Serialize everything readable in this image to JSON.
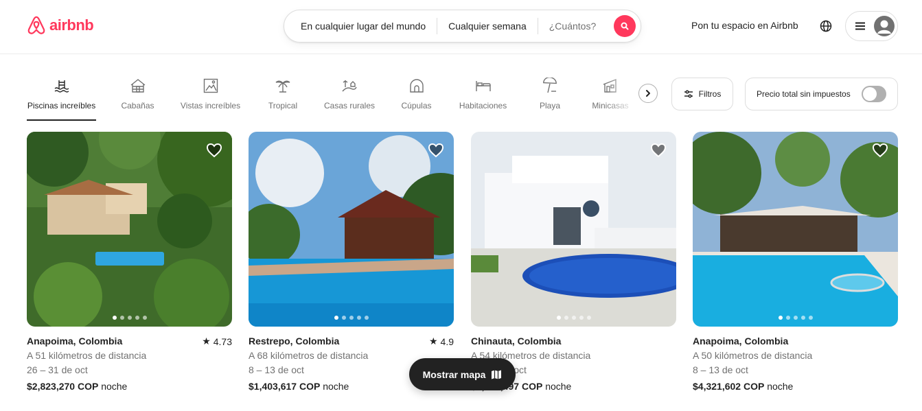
{
  "header": {
    "logo_text": "airbnb",
    "search": {
      "where": "En cualquier lugar del mundo",
      "when": "Cualquier semana",
      "guests": "¿Cuántos?"
    },
    "host_link": "Pon tu espacio en Airbnb"
  },
  "categories": [
    {
      "label": "Piscinas increíbles",
      "icon": "pool-icon",
      "active": true
    },
    {
      "label": "Cabañas",
      "icon": "cabin-icon"
    },
    {
      "label": "Vistas increíbles",
      "icon": "views-icon"
    },
    {
      "label": "Tropical",
      "icon": "palm-icon"
    },
    {
      "label": "Casas rurales",
      "icon": "countryside-icon"
    },
    {
      "label": "Cúpulas",
      "icon": "dome-icon"
    },
    {
      "label": "Habitaciones",
      "icon": "bed-icon"
    },
    {
      "label": "Playa",
      "icon": "umbrella-icon"
    },
    {
      "label": "Minicasas",
      "icon": "tiny-home-icon"
    }
  ],
  "filters_label": "Filtros",
  "price_toggle_label": "Precio total sin impuestos",
  "price_toggle_on": false,
  "listings": [
    {
      "location": "Anapoima, Colombia",
      "rating": "4.73",
      "distance": "A 51 kilómetros de distancia",
      "dates": "26 – 31 de oct",
      "price": "$2,823,270 COP",
      "price_unit": "noche"
    },
    {
      "location": "Restrepo, Colombia",
      "rating": "4.9",
      "distance": "A 68 kilómetros de distancia",
      "dates": "8 – 13 de oct",
      "price": "$1,403,617 COP",
      "price_unit": "noche"
    },
    {
      "location": "Chinauta, Colombia",
      "rating": "",
      "distance": "A 54 kilómetros de distancia",
      "dates": "8 – 13 de oct",
      "price": "$1,808,497 COP",
      "price_unit": "noche"
    },
    {
      "location": "Anapoima, Colombia",
      "rating": "",
      "distance": "A 50 kilómetros de distancia",
      "dates": "8 – 13 de oct",
      "price": "$4,321,602 COP",
      "price_unit": "noche"
    }
  ],
  "map_button_label": "Mostrar mapa",
  "colors": {
    "brand": "#ff385c",
    "text": "#222222",
    "muted": "#717171"
  }
}
